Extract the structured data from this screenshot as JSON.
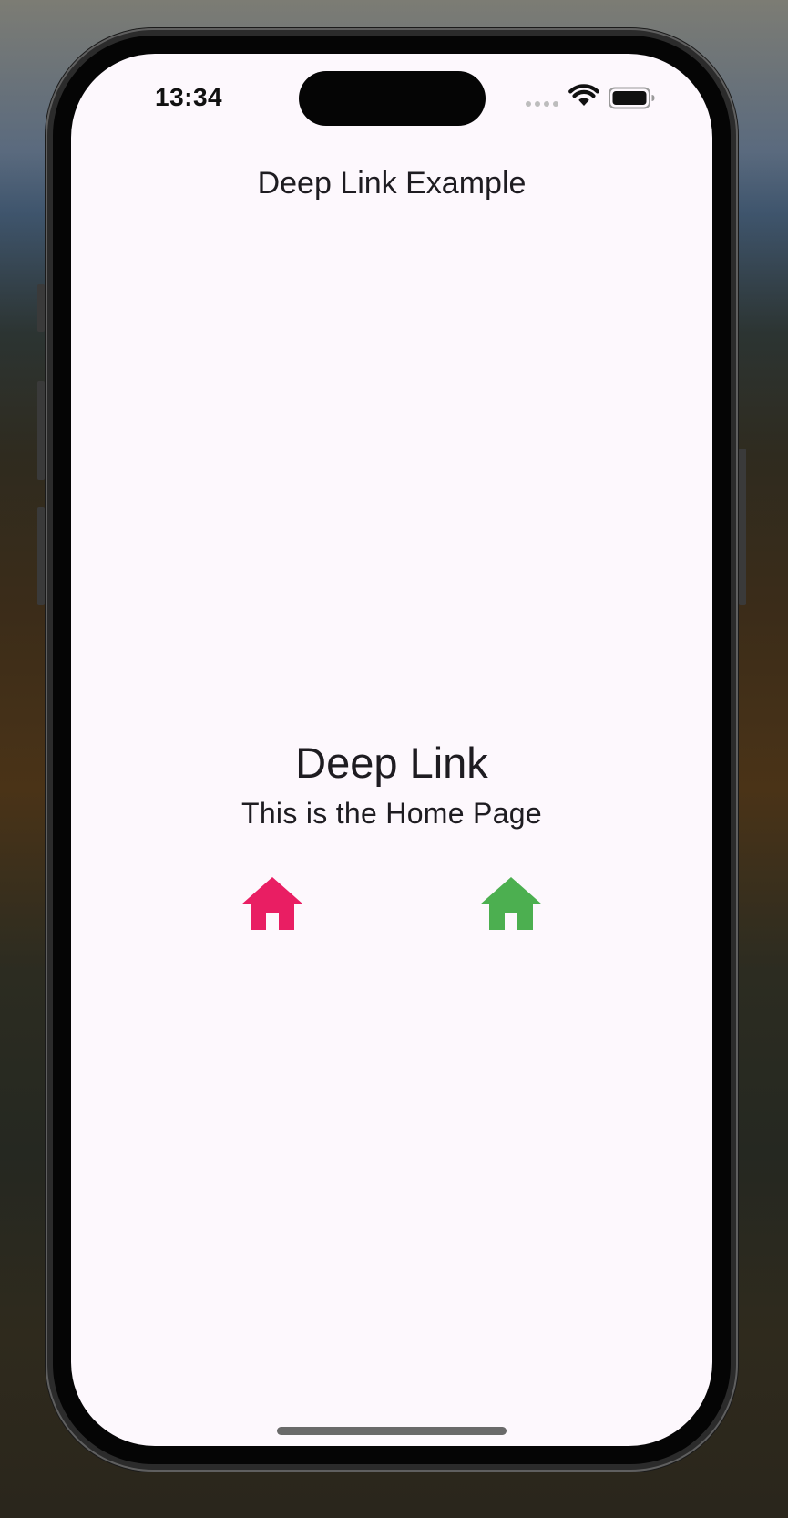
{
  "status_bar": {
    "time": "13:34"
  },
  "app_bar": {
    "title": "Deep Link Example"
  },
  "content": {
    "heading": "Deep Link",
    "subheading": "This is the Home Page"
  },
  "buttons": [
    {
      "icon": "home-icon",
      "color": "#e91e63"
    },
    {
      "icon": "home-icon",
      "color": "#4caf50"
    }
  ],
  "colors": {
    "screen_background": "#fdf8fd",
    "text": "#1e1c21",
    "pink_accent": "#e91e63",
    "green_accent": "#4caf50"
  }
}
